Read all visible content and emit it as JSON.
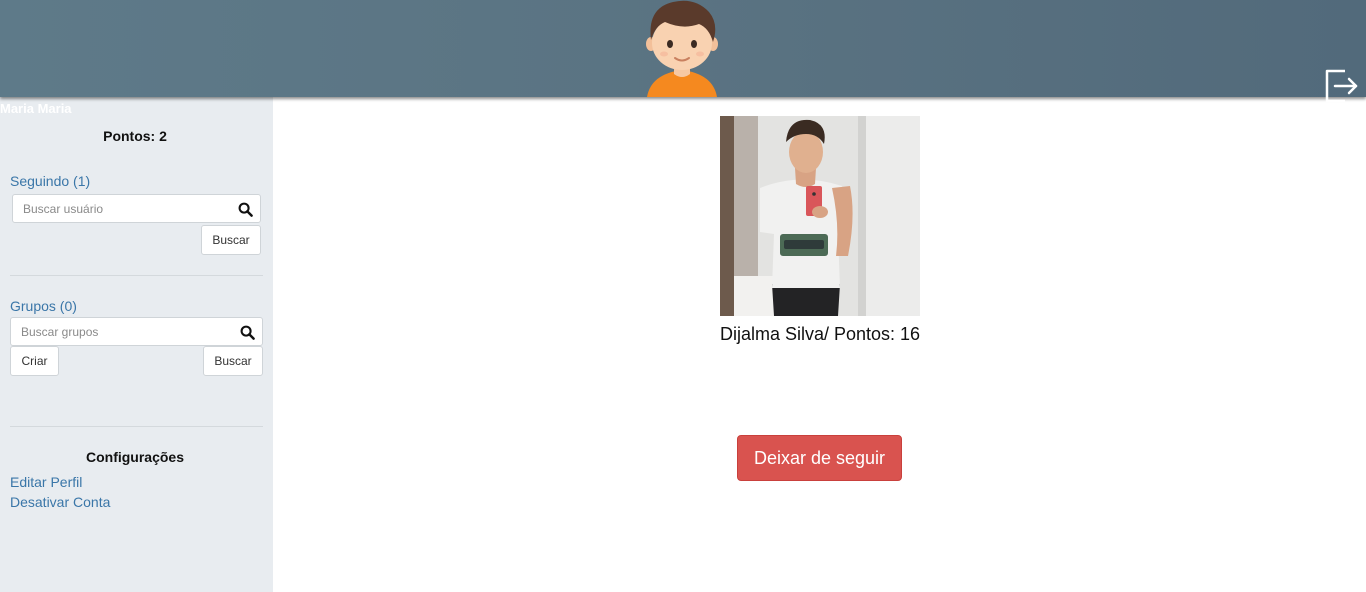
{
  "header": {
    "avatar_icon": "boy-avatar-icon",
    "logout_icon": "logout-icon",
    "colors": {
      "bar": "#5a7382"
    }
  },
  "sidebar": {
    "username": "Maria Maria",
    "points": "Pontos: 2",
    "following": {
      "label": "Seguindo (1)",
      "search_placeholder": "Buscar usuário",
      "search_button": "Buscar"
    },
    "groups": {
      "label": "Grupos (0)",
      "search_placeholder": "Buscar grupos",
      "create_button": "Criar",
      "search_button": "Buscar"
    },
    "settings": {
      "title": "Configurações",
      "edit_profile": "Editar Perfil",
      "deactivate_account": "Desativar Conta"
    },
    "colors": {
      "background": "#e8ecf0",
      "link": "#3a76a8"
    }
  },
  "main": {
    "profile": {
      "caption": "Dijalma Silva/ Pontos: 16"
    },
    "unfollow_button": "Deixar de seguir",
    "colors": {
      "danger": "#d9534f"
    }
  }
}
